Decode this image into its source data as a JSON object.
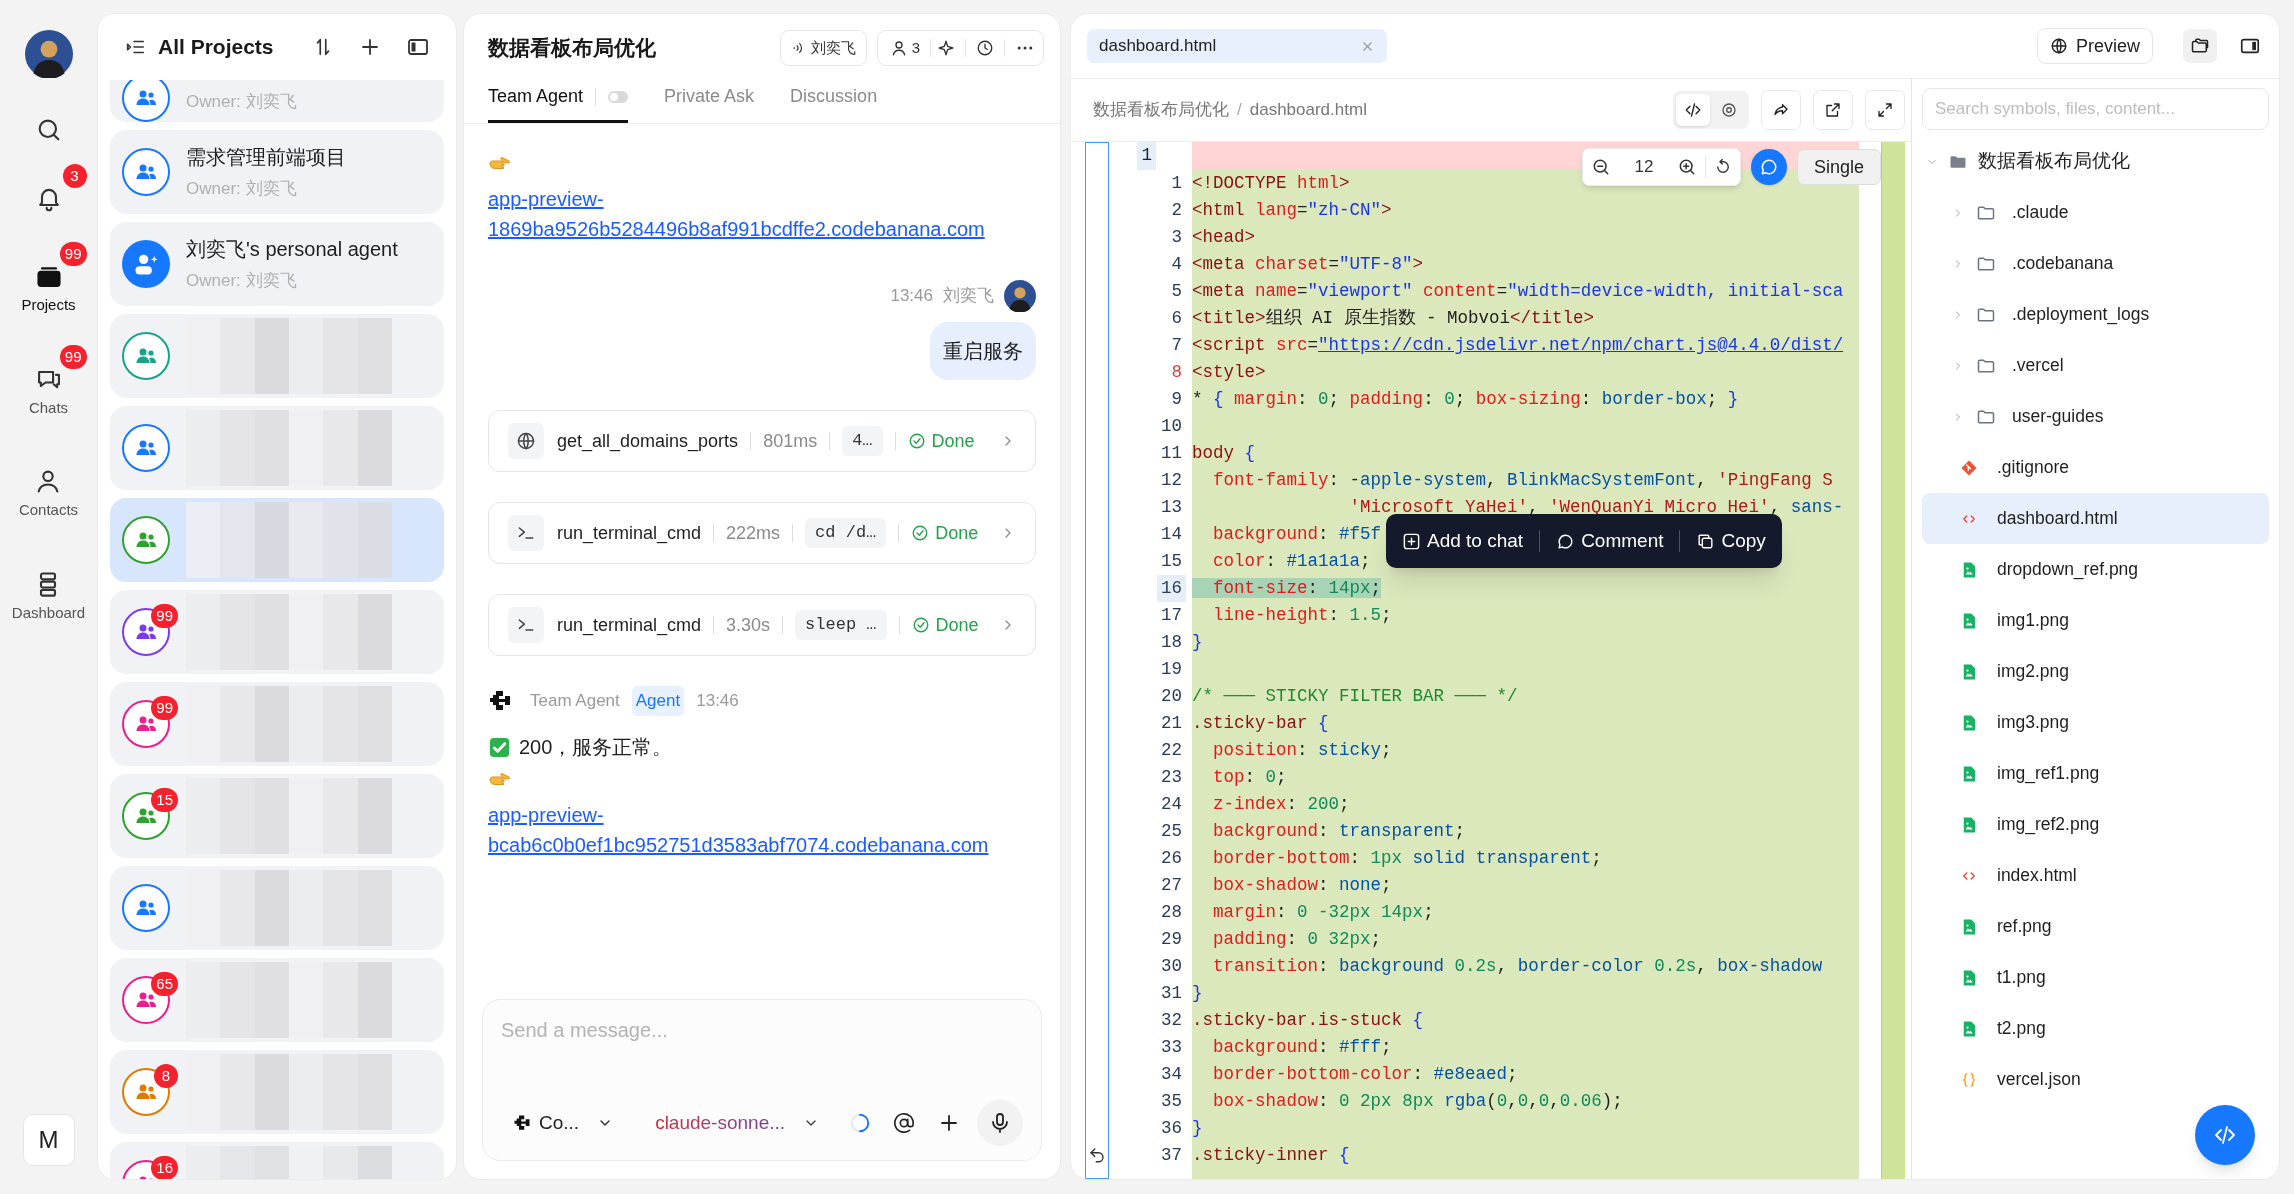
{
  "rail": {
    "items": [
      {
        "kind": "search",
        "selected": false
      },
      {
        "kind": "bell",
        "badge": "3",
        "selected": false
      },
      {
        "kind": "projects",
        "label": "Projects",
        "badge": "99",
        "selected": true
      },
      {
        "kind": "chats",
        "label": "Chats",
        "badge": "99",
        "selected": false
      },
      {
        "kind": "contacts",
        "label": "Contacts",
        "selected": false
      },
      {
        "kind": "dashboard",
        "label": "Dashboard",
        "selected": false
      }
    ],
    "user_button": "M"
  },
  "projects": {
    "title": "All Projects",
    "items": [
      {
        "owner": "Owner: 刘奕飞",
        "kind": "group",
        "color": "#1677ff",
        "clipped": true,
        "selected": false
      },
      {
        "name": "需求管理前端项目",
        "owner": "Owner: 刘奕飞",
        "kind": "group",
        "color": "#1677ff",
        "selected": false
      },
      {
        "name": "刘奕飞's personal agent",
        "owner": "Owner: 刘奕飞",
        "kind": "personal",
        "color": "#1677ff",
        "selected": false
      },
      {
        "redacted": true,
        "kind": "group",
        "color": "#12a58a",
        "selected": false
      },
      {
        "redacted": true,
        "kind": "group",
        "color": "#1677ff",
        "selected": false
      },
      {
        "redacted": true,
        "kind": "group",
        "color": "#2ea12e",
        "selected": true
      },
      {
        "redacted": true,
        "kind": "group",
        "color": "#7c3aed",
        "badge": "99",
        "selected": false
      },
      {
        "redacted": true,
        "kind": "group",
        "color": "#ec1e8c",
        "badge": "99",
        "selected": false
      },
      {
        "redacted": true,
        "kind": "group",
        "color": "#2ea12e",
        "badge": "15",
        "selected": false
      },
      {
        "redacted": true,
        "kind": "group",
        "color": "#1677ff",
        "selected": false
      },
      {
        "redacted": true,
        "kind": "group",
        "color": "#ec1e8c",
        "badge": "65",
        "selected": false
      },
      {
        "redacted": true,
        "kind": "group",
        "color": "#e07b00",
        "badge": "8",
        "selected": false
      },
      {
        "redacted": true,
        "kind": "group",
        "color": "#ec1e8c",
        "badge": "16",
        "selected": false
      }
    ]
  },
  "chat": {
    "title": "数据看板布局优化",
    "speaker": "刘奕飞",
    "members": "3",
    "tabs": [
      {
        "label": "Team Agent",
        "selected": true,
        "toggle": false
      },
      {
        "label": "Private Ask",
        "selected": false
      },
      {
        "label": "Discussion",
        "selected": false
      }
    ],
    "messages": [
      {
        "kind": "link",
        "url": "app-preview-1869ba9526b5284496b8af991bcdffe2.codebanana.com"
      },
      {
        "kind": "user",
        "time": "13:46",
        "author": "刘奕飞",
        "text": "重启服务"
      },
      {
        "kind": "web_tool",
        "name": "get_all_domains_ports",
        "duration": "801ms",
        "arg": "4…",
        "done": true,
        "status": "Done"
      },
      {
        "kind": "shell_tool",
        "name": "run_terminal_cmd",
        "duration": "222ms",
        "arg": "cd /d…",
        "done": true,
        "status": "Done"
      },
      {
        "kind": "shell_tool",
        "name": "run_terminal_cmd",
        "duration": "3.30s",
        "arg": "sleep …",
        "done": true,
        "status": "Done"
      },
      {
        "kind": "agent",
        "author": "Team Agent",
        "role": "Agent",
        "time": "13:46"
      },
      {
        "kind": "text",
        "check": true,
        "text": "200，服务正常。"
      },
      {
        "kind": "link",
        "url": "app-preview-bcab6c0b0ef1bc952751d3583abf7074.codebanana.com"
      }
    ],
    "composer": {
      "placeholder": "Send a message...",
      "agent": "Co...",
      "model": "claude-sonne..."
    }
  },
  "editor": {
    "tabs": [
      {
        "label": "dashboard.html",
        "selected": true
      }
    ],
    "preview_button": "Preview",
    "breadcrumb": {
      "items": [
        "数据看板布局优化",
        "dashboard.html"
      ],
      "separator": "/"
    },
    "view_modes": [
      {
        "kind": "code",
        "selected": true
      },
      {
        "kind": "preview",
        "selected": false
      }
    ],
    "zoom": "12",
    "layout_button": "Single",
    "selection_menu": [
      {
        "kind": "add",
        "label": "Add to chat"
      },
      {
        "kind": "comment",
        "label": "Comment"
      },
      {
        "kind": "copy",
        "label": "Copy"
      }
    ],
    "header_line": "1",
    "lines": [
      {
        "n": "1",
        "text": "<!DOCTYPE html>",
        "selected": false,
        "flagged": false
      },
      {
        "n": "2",
        "text": "<html lang=\"zh-CN\">",
        "selected": false,
        "flagged": false
      },
      {
        "n": "3",
        "text": "<head>",
        "selected": false,
        "flagged": false
      },
      {
        "n": "4",
        "text": "<meta charset=\"UTF-8\">",
        "selected": false,
        "flagged": false
      },
      {
        "n": "5",
        "text": "<meta name=\"viewport\" content=\"width=device-width, initial-sca",
        "selected": false,
        "flagged": false
      },
      {
        "n": "6",
        "text": "<title>组织 AI 原生指数 - Mobvoi</title>",
        "selected": false,
        "flagged": false
      },
      {
        "n": "7",
        "text": "<script src=\"https://cdn.jsdelivr.net/npm/chart.js@4.4.0/dist/",
        "selected": false,
        "flagged": false
      },
      {
        "n": "8",
        "text": "<style>",
        "selected": false,
        "flagged": true
      },
      {
        "n": "9",
        "text": "* { margin: 0; padding: 0; box-sizing: border-box; }",
        "selected": false,
        "flagged": false
      },
      {
        "n": "10",
        "selected": false,
        "flagged": false
      },
      {
        "n": "11",
        "text": "body {",
        "selected": false,
        "flagged": false
      },
      {
        "n": "12",
        "text": "  font-family: -apple-system, BlinkMacSystemFont, 'PingFang S",
        "selected": false,
        "flagged": false
      },
      {
        "n": "13",
        "text": "               'Microsoft YaHei', 'WenQuanYi Micro Hei', sans-",
        "selected": false,
        "flagged": false
      },
      {
        "n": "14",
        "text": "  background: #f5f",
        "selected": false,
        "flagged": false
      },
      {
        "n": "15",
        "text": "  color: #1a1a1a;",
        "selected": false,
        "flagged": false
      },
      {
        "n": "16",
        "text": "  font-size: 14px;",
        "selected": true,
        "flagged": false
      },
      {
        "n": "17",
        "text": "  line-height: 1.5;",
        "selected": false,
        "flagged": false
      },
      {
        "n": "18",
        "text": "}",
        "selected": false,
        "flagged": false
      },
      {
        "n": "19",
        "selected": false,
        "flagged": false
      },
      {
        "n": "20",
        "text": "/* ─── STICKY FILTER BAR ─── */",
        "selected": false,
        "flagged": false
      },
      {
        "n": "21",
        "text": ".sticky-bar {",
        "selected": false,
        "flagged": false
      },
      {
        "n": "22",
        "text": "  position: sticky;",
        "selected": false,
        "flagged": false
      },
      {
        "n": "23",
        "text": "  top: 0;",
        "selected": false,
        "flagged": false
      },
      {
        "n": "24",
        "text": "  z-index: 200;",
        "selected": false,
        "flagged": false
      },
      {
        "n": "25",
        "text": "  background: transparent;",
        "selected": false,
        "flagged": false
      },
      {
        "n": "26",
        "text": "  border-bottom: 1px solid transparent;",
        "selected": false,
        "flagged": false
      },
      {
        "n": "27",
        "text": "  box-shadow: none;",
        "selected": false,
        "flagged": false
      },
      {
        "n": "28",
        "text": "  margin: 0 -32px 14px;",
        "selected": false,
        "flagged": false
      },
      {
        "n": "29",
        "text": "  padding: 0 32px;",
        "selected": false,
        "flagged": false
      },
      {
        "n": "30",
        "text": "  transition: background 0.2s, border-color 0.2s, box-shadow",
        "selected": false,
        "flagged": false
      },
      {
        "n": "31",
        "text": "}",
        "selected": false,
        "flagged": false
      },
      {
        "n": "32",
        "text": ".sticky-bar.is-stuck {",
        "selected": false,
        "flagged": false
      },
      {
        "n": "33",
        "text": "  background: #fff;",
        "selected": false,
        "flagged": false
      },
      {
        "n": "34",
        "text": "  border-bottom-color: #e8eaed;",
        "selected": false,
        "flagged": false
      },
      {
        "n": "35",
        "text": "  box-shadow: 0 2px 8px rgba(0,0,0,0.06);",
        "selected": false,
        "flagged": false
      },
      {
        "n": "36",
        "text": "}",
        "selected": false,
        "flagged": false
      },
      {
        "n": "37",
        "text": ".sticky-inner {",
        "selected": false,
        "flagged": false
      }
    ]
  },
  "files": {
    "search_placeholder": "Search symbols, files, content...",
    "root": {
      "name": "数据看板布局优化",
      "expanded": true,
      "children": [
        {
          "name": ".claude",
          "kind": "folder",
          "expanded": false,
          "selected": false
        },
        {
          "name": ".codebanana",
          "kind": "folder",
          "expanded": false,
          "selected": false
        },
        {
          "name": ".deployment_logs",
          "kind": "folder",
          "expanded": false,
          "selected": false
        },
        {
          "name": ".vercel",
          "kind": "folder",
          "expanded": false,
          "selected": false
        },
        {
          "name": "user-guides",
          "kind": "folder",
          "expanded": false,
          "selected": false
        },
        {
          "name": ".gitignore",
          "kind": "git",
          "selected": false
        },
        {
          "name": "dashboard.html",
          "kind": "html",
          "selected": true
        },
        {
          "name": "dropdown_ref.png",
          "kind": "image",
          "selected": false
        },
        {
          "name": "img1.png",
          "kind": "image",
          "selected": false
        },
        {
          "name": "img2.png",
          "kind": "image",
          "selected": false
        },
        {
          "name": "img3.png",
          "kind": "image",
          "selected": false
        },
        {
          "name": "img_ref1.png",
          "kind": "image",
          "selected": false
        },
        {
          "name": "img_ref2.png",
          "kind": "image",
          "selected": false
        },
        {
          "name": "index.html",
          "kind": "html",
          "selected": false
        },
        {
          "name": "ref.png",
          "kind": "image",
          "selected": false
        },
        {
          "name": "t1.png",
          "kind": "image",
          "selected": false
        },
        {
          "name": "t2.png",
          "kind": "image",
          "selected": false
        },
        {
          "name": "vercel.json",
          "kind": "json",
          "selected": false
        }
      ]
    }
  }
}
